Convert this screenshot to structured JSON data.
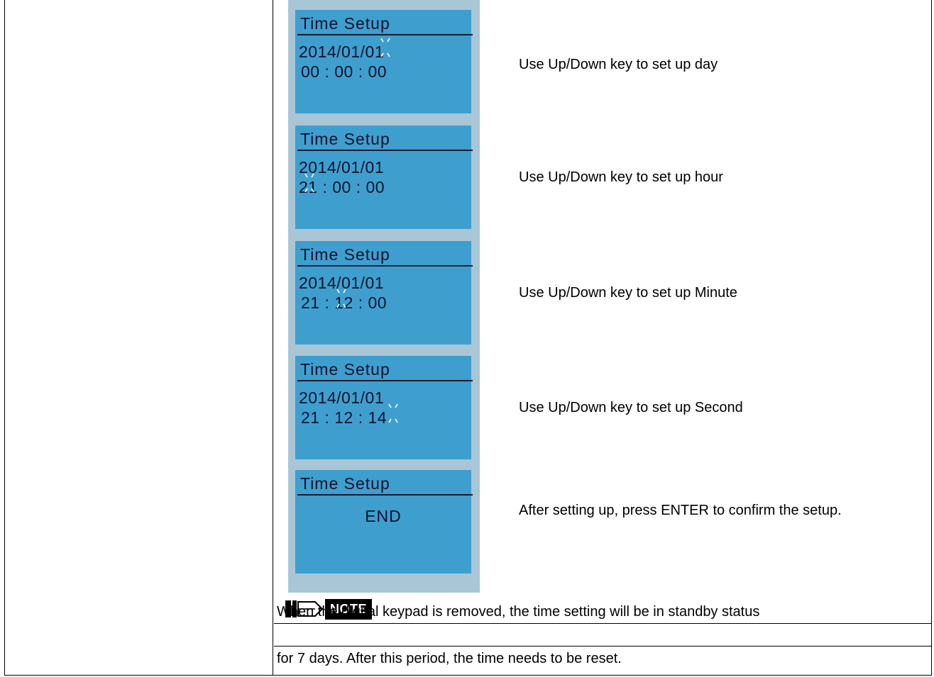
{
  "screens": [
    {
      "title": "Time Setup",
      "line1": "2014/01/01",
      "line2": "00 : 00 : 00",
      "blink": "day",
      "description": "Use Up/Down key to set up day"
    },
    {
      "title": "Time Setup",
      "line1": "2014/01/01",
      "line2": "21 : 00 : 00",
      "blink": "hour",
      "description": "Use Up/Down key to set up hour"
    },
    {
      "title": "Time Setup",
      "line1": "2014/01/01",
      "line2": "21 : 12 : 00",
      "blink": "minute",
      "description": "Use Up/Down key to set up Minute"
    },
    {
      "title": "Time Setup",
      "line1": "2014/01/01",
      "line2": "21 : 12 : 14",
      "blink": "second",
      "description": "Use Up/Down key to set up Second"
    },
    {
      "title": "Time Setup",
      "end_text": "END",
      "description": "After setting up, press ENTER to confirm the setup."
    }
  ],
  "note": {
    "label": "NOTE",
    "line1": "When the digital keypad is removed, the time setting will be in standby status",
    "line2": "for 7 days. After this period, the time needs to be reset."
  },
  "colors": {
    "lcd_background": "#3e9fcf",
    "lcd_frame": "#a9c6d6",
    "lcd_text": "#11112a"
  }
}
